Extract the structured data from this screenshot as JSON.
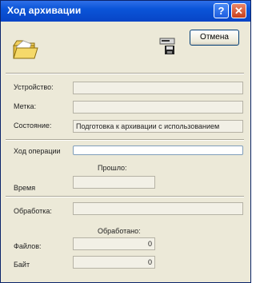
{
  "window": {
    "title": "Ход архивации",
    "help_label": "?",
    "close_label": "✕"
  },
  "buttons": {
    "cancel_label": "Отмена"
  },
  "labels": {
    "device": "Устройство:",
    "label": "Метка:",
    "status": "Состояние:",
    "progress": "Ход операции",
    "elapsed": "Прошло:",
    "time": "Время",
    "processing": "Обработка:",
    "processed": "Обработано:",
    "files": "Файлов:",
    "bytes": "Байт"
  },
  "values": {
    "device": "",
    "label": "",
    "status": "Подготовка к архивации с использованием",
    "time": "",
    "processing": "",
    "files": "0",
    "bytes": "0"
  },
  "progress_fraction": 0,
  "icons": {
    "folder": "folder-icon",
    "backup_device": "backup-device-icon"
  }
}
